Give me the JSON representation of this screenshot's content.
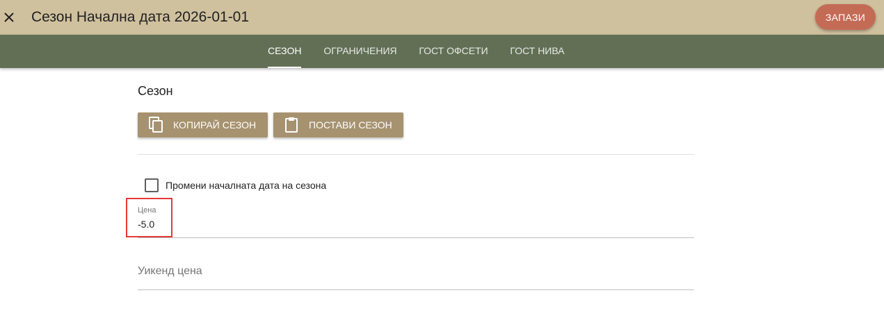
{
  "header": {
    "title": "Сезон Начална дата 2026-01-01",
    "save_label": "ЗАПАЗИ",
    "close_icon": "close-icon"
  },
  "tabs": [
    {
      "label": "СЕЗОН",
      "active": true
    },
    {
      "label": "ОГРАНИЧЕНИЯ",
      "active": false
    },
    {
      "label": "ГОСТ ОФСЕТИ",
      "active": false
    },
    {
      "label": "ГОСТ НИВА",
      "active": false
    }
  ],
  "season": {
    "title": "Сезон",
    "copy_label": "КОПИРАЙ СЕЗОН",
    "copy_icon": "copy-icon",
    "paste_label": "ПОСТАВИ СЕЗОН",
    "paste_icon": "clipboard-icon",
    "change_start_label": "Промени началната дата на сезона",
    "change_start_checked": false
  },
  "fields": {
    "price_label": "Цена",
    "price_value": "-5.0",
    "weekend_placeholder": "Уикенд цена",
    "weekend_value": ""
  },
  "colors": {
    "header_bg": "#d0c19e",
    "tabbar_bg": "#626f55",
    "save_button": "#c46b56",
    "action_button": "#a6926f",
    "highlight": "#e53935"
  }
}
